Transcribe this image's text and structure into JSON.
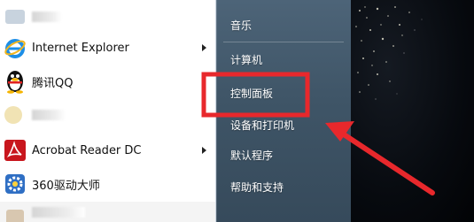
{
  "left_pane": {
    "programs": [
      {
        "label": "",
        "icon": "blurred-app-icon",
        "submenu": false
      },
      {
        "label": "Internet Explorer",
        "icon": "internet-explorer-icon",
        "submenu": true
      },
      {
        "label": "腾讯QQ",
        "icon": "qq-penguin-icon",
        "submenu": false
      },
      {
        "label": "",
        "icon": "blurred-app-icon",
        "submenu": false
      },
      {
        "label": "Acrobat Reader DC",
        "icon": "acrobat-reader-icon",
        "submenu": true
      },
      {
        "label": "360驱动大师",
        "icon": "driver-master-icon",
        "submenu": false
      },
      {
        "label": "",
        "icon": "blurred-app-icon",
        "submenu": false
      }
    ]
  },
  "right_pane": {
    "items": [
      {
        "label": "音乐"
      },
      {
        "label": "计算机"
      },
      {
        "label": "控制面板"
      },
      {
        "label": "设备和打印机"
      },
      {
        "label": "默认程序"
      },
      {
        "label": "帮助和支持"
      }
    ]
  },
  "annotation": {
    "highlight_color": "#e8282c",
    "arrow_color": "#e8282c"
  }
}
